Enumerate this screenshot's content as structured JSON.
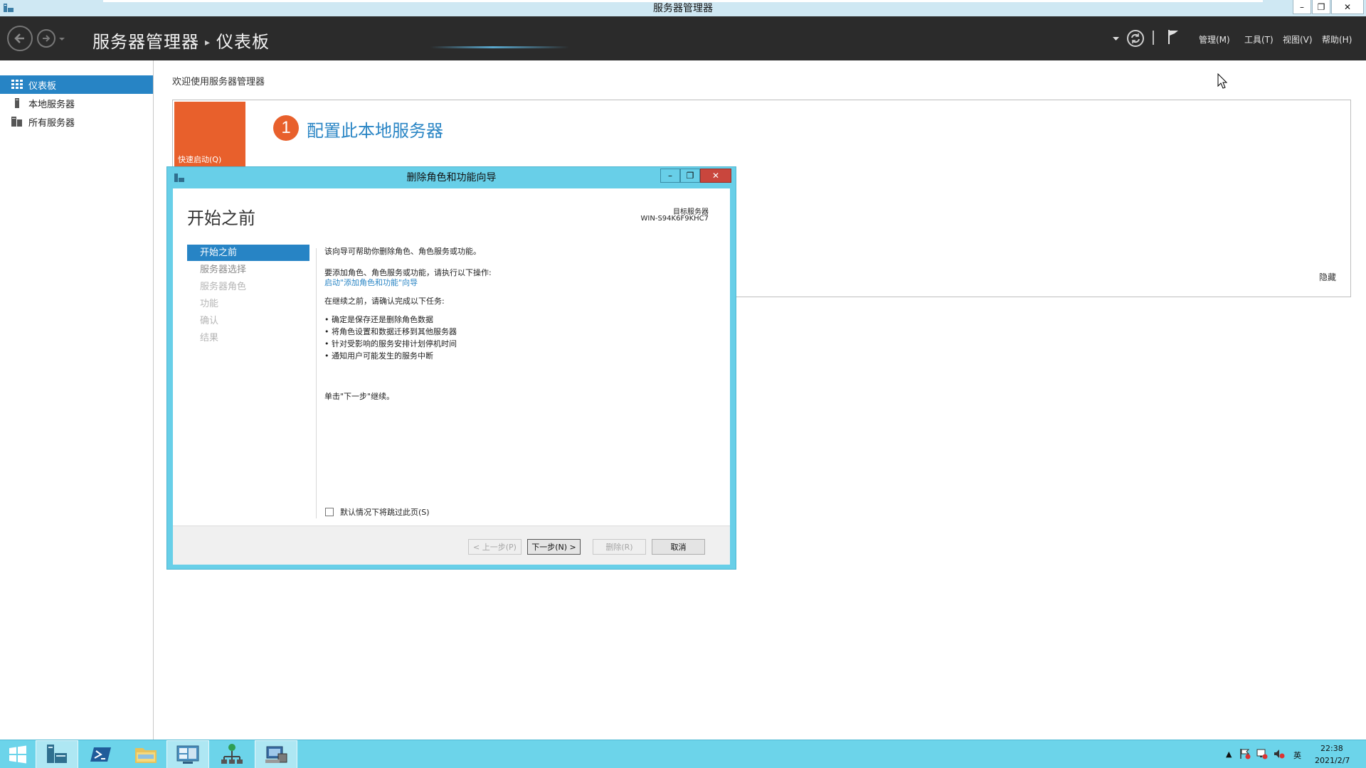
{
  "window": {
    "title": "服务器管理器",
    "minimize": "–",
    "restore": "❐",
    "close": "✕"
  },
  "header": {
    "breadcrumb_root": "服务器管理器",
    "breadcrumb_sep": "▸",
    "breadcrumb_current": "仪表板",
    "menu": {
      "manage": "管理(M)",
      "tools": "工具(T)",
      "view": "视图(V)",
      "help": "帮助(H)"
    }
  },
  "sidebar": {
    "items": [
      {
        "label": "仪表板",
        "active": true
      },
      {
        "label": "本地服务器",
        "active": false
      },
      {
        "label": "所有服务器",
        "active": false
      }
    ]
  },
  "main": {
    "welcome": "欢迎使用服务器管理器",
    "quick_start": "快速启动(Q)",
    "step_number": "1",
    "step_title": "配置此本地服务器",
    "hide": "隐藏"
  },
  "wizard": {
    "title": "删除角色和功能向导",
    "heading": "开始之前",
    "target_label": "目标服务器",
    "target_name": "WIN-S94K6F9KHC7",
    "steps": [
      {
        "label": "开始之前",
        "state": "active"
      },
      {
        "label": "服务器选择",
        "state": "enabled"
      },
      {
        "label": "服务器角色",
        "state": "disabled"
      },
      {
        "label": "功能",
        "state": "disabled"
      },
      {
        "label": "确认",
        "state": "disabled"
      },
      {
        "label": "结果",
        "state": "disabled"
      }
    ],
    "intro": "该向导可帮助你删除角色、角色服务或功能。",
    "add_hint": "要添加角色、角色服务或功能，请执行以下操作:",
    "add_link": "启动\"添加角色和功能\"向导",
    "before_continue": "在继续之前，请确认完成以下任务:",
    "tasks": [
      "• 确定是保存还是删除角色数据",
      "• 将角色设置和数据迁移到其他服务器",
      "• 针对受影响的服务安排计划停机时间",
      "• 通知用户可能发生的服务中断"
    ],
    "click_next": "单击\"下一步\"继续。",
    "skip_label": "默认情况下将跳过此页(S)",
    "buttons": {
      "prev": "< 上一步(P)",
      "next": "下一步(N) >",
      "remove": "删除(R)",
      "cancel": "取消"
    }
  },
  "taskbar": {
    "tray_arrow": "▲",
    "ime": "英",
    "time": "22:38",
    "date": "2021/2/7"
  },
  "colors": {
    "accent_blue": "#2784c5",
    "orange": "#e8602c",
    "header_dark": "#2b2b2b",
    "taskbar": "#6cd4ea"
  }
}
